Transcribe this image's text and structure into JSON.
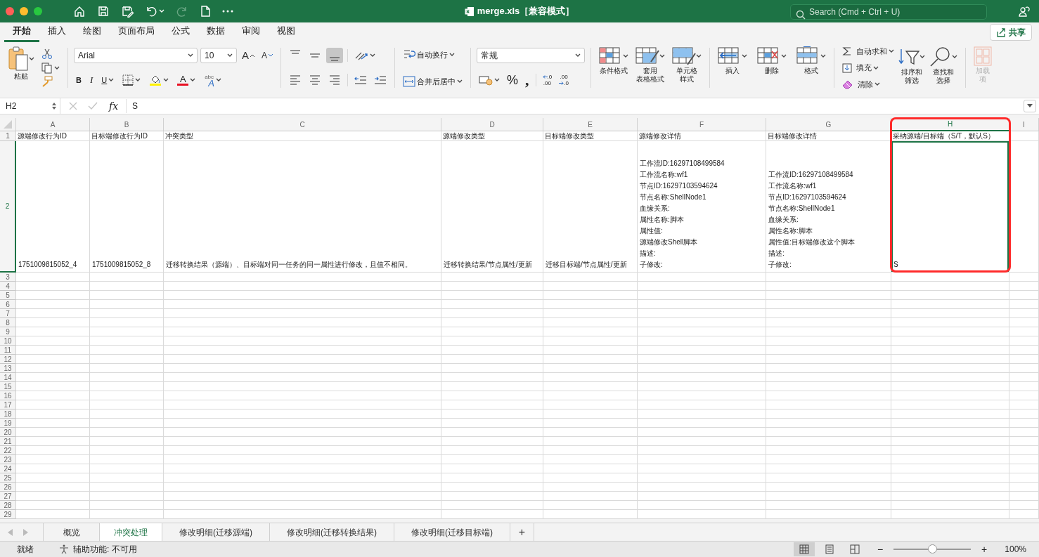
{
  "window": {
    "title": "merge.xls［兼容模式］",
    "search_placeholder": "Search (Cmd + Ctrl + U)",
    "redo_disabled": true
  },
  "ribbon_tabs": [
    {
      "label": "开始",
      "selected": true
    },
    {
      "label": "插入",
      "selected": false
    },
    {
      "label": "绘图",
      "selected": false
    },
    {
      "label": "页面布局",
      "selected": false
    },
    {
      "label": "公式",
      "selected": false
    },
    {
      "label": "数据",
      "selected": false
    },
    {
      "label": "审阅",
      "selected": false
    },
    {
      "label": "视图",
      "selected": false
    }
  ],
  "share_button": "共享",
  "ribbon": {
    "paste": "粘贴",
    "font_name": "Arial",
    "font_size": "10",
    "grow_font": "A",
    "shrink_font": "A",
    "bold": "B",
    "italic": "I",
    "underline": "U",
    "font_color": "A",
    "phonetic": {
      "top": "abc",
      "main": "A"
    },
    "vertical_align": [
      {
        "selected": false
      },
      {
        "selected": false
      },
      {
        "selected": true
      }
    ],
    "wrap_text": "自动换行",
    "merge_center": "合并后居中",
    "number_format": "常规",
    "percent": "%",
    "comma": ",",
    "decimals": [
      {
        "top": ".0",
        "bottom": ".00"
      },
      {
        "top": ".00",
        "bottom": ".0"
      }
    ],
    "styles": [
      [
        "条件格式"
      ],
      [
        "套用",
        "表格格式"
      ],
      [
        "单元格",
        "样式"
      ]
    ],
    "cells": [
      "插入",
      "删除",
      "格式"
    ],
    "editing": [
      "自动求和",
      "填充",
      "清除"
    ],
    "sort_filter": [
      "排序和",
      "筛选"
    ],
    "find_select": [
      "查找和",
      "选择"
    ],
    "addins": {
      "label": [
        "加载",
        "项"
      ],
      "disabled": true
    }
  },
  "formula_bar": {
    "name_box": "H2",
    "fx": "fx",
    "value": "S",
    "buttons_disabled": true
  },
  "sheet": {
    "columns": [
      {
        "letter": "A",
        "selected": false,
        "highlighted": false
      },
      {
        "letter": "B",
        "selected": false,
        "highlighted": false
      },
      {
        "letter": "C",
        "selected": false,
        "highlighted": false
      },
      {
        "letter": "D",
        "selected": false,
        "highlighted": false
      },
      {
        "letter": "E",
        "selected": false,
        "highlighted": false
      },
      {
        "letter": "F",
        "selected": false,
        "highlighted": false
      },
      {
        "letter": "G",
        "selected": false,
        "highlighted": false
      },
      {
        "letter": "H",
        "selected": true,
        "highlighted": true
      },
      {
        "letter": "I",
        "selected": false,
        "highlighted": false
      }
    ],
    "rows": [
      {
        "number": "1",
        "selected": false,
        "cells": [
          "源端修改行为ID",
          "目标端修改行为ID",
          "冲突类型",
          "源端修改类型",
          "目标端修改类型",
          "源端修改详情",
          "目标端修改详情",
          "采纳源端/目标端（S/T，默认S）"
        ]
      },
      {
        "number": "2",
        "selected": true,
        "cells": [
          "1751009815052_4",
          "1751009815052_8",
          "迁移转换结果（源端）、目标端对同一任务的同一属性进行修改，且值不相同。",
          "迁移转换结果/节点属性/更新",
          "迁移目标端/节点属性/更新",
          [
            "工作流ID:16297108499584",
            "工作流名称:wf1",
            "节点ID:16297103594624",
            "节点名称:ShellNode1",
            "血缘关系:",
            "属性名称:脚本",
            "属性值:",
            "源端修改Shell脚本",
            "描述:",
            "子修改:"
          ],
          [
            "工作流ID:16297108499584",
            "工作流名称:wf1",
            "节点ID:16297103594624",
            "节点名称:ShellNode1",
            "血缘关系:",
            "属性名称:脚本",
            "属性值:目标端修改这个脚本",
            "描述:",
            "子修改:"
          ],
          "S"
        ]
      },
      {
        "number": "3",
        "selected": false
      },
      {
        "number": "4",
        "selected": false
      },
      {
        "number": "5",
        "selected": false
      },
      {
        "number": "6",
        "selected": false
      },
      {
        "number": "7",
        "selected": false
      },
      {
        "number": "8",
        "selected": false
      },
      {
        "number": "9",
        "selected": false
      },
      {
        "number": "10",
        "selected": false
      },
      {
        "number": "11",
        "selected": false
      },
      {
        "number": "12",
        "selected": false
      },
      {
        "number": "13",
        "selected": false
      },
      {
        "number": "14",
        "selected": false
      },
      {
        "number": "15",
        "selected": false
      },
      {
        "number": "16",
        "selected": false
      },
      {
        "number": "17",
        "selected": false
      },
      {
        "number": "18",
        "selected": false
      },
      {
        "number": "19",
        "selected": false
      },
      {
        "number": "20",
        "selected": false
      },
      {
        "number": "21",
        "selected": false
      },
      {
        "number": "22",
        "selected": false
      },
      {
        "number": "23",
        "selected": false
      },
      {
        "number": "24",
        "selected": false
      },
      {
        "number": "25",
        "selected": false
      },
      {
        "number": "26",
        "selected": false
      },
      {
        "number": "27",
        "selected": false
      },
      {
        "number": "28",
        "selected": false
      },
      {
        "number": "29",
        "selected": false
      }
    ]
  },
  "sheet_nav_disabled": true,
  "sheet_tabs": [
    {
      "label": "概览",
      "selected": false
    },
    {
      "label": "冲突处理",
      "selected": true
    },
    {
      "label": "修改明细(迁移源端)",
      "selected": false
    },
    {
      "label": "修改明细(迁移转换结果)",
      "selected": false
    },
    {
      "label": "修改明细(迁移目标端)",
      "selected": false
    }
  ],
  "add_sheet": "+",
  "status_bar": {
    "ready": "就绪",
    "accessibility": "辅助功能: 不可用",
    "views": [
      {
        "kind": "normal",
        "selected": true
      },
      {
        "kind": "page-layout",
        "selected": false
      },
      {
        "kind": "page-break",
        "selected": false
      }
    ],
    "zoom_out": "−",
    "zoom": {
      "level": 0.5
    },
    "zoom_in": "+",
    "zoom_label": "100%"
  }
}
